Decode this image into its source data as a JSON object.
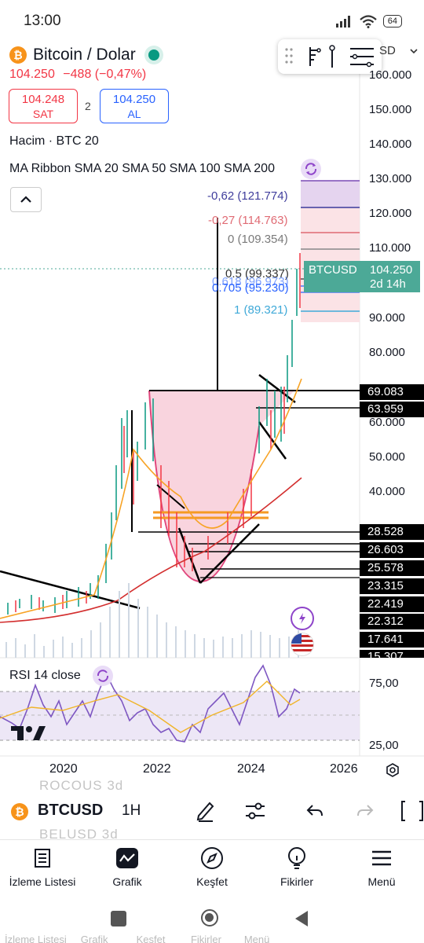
{
  "status_bar": {
    "time": "13:00",
    "battery": "64"
  },
  "header": {
    "symbol_title": "Bitcoin / Dolar",
    "price": "104.250",
    "change": "−488 (−0,47%)",
    "sell_price": "104.248",
    "sell_label": "SAT",
    "spread": "2",
    "buy_price": "104.250",
    "buy_label": "AL",
    "currency_partial": "SD"
  },
  "indicators": {
    "volume": "Hacim · BTC 20",
    "ma_ribbon": "MA Ribbon SMA 20 SMA 50 SMA 100 SMA 200",
    "rsi": "RSI 14 close"
  },
  "price_axis": [
    "160.000",
    "150.000",
    "140.000",
    "130.000",
    "120.000",
    "110.000",
    "90.000",
    "80.000",
    "60.000",
    "50.000",
    "40.000"
  ],
  "price_marks": [
    "69.083",
    "63.959",
    "28.528",
    "26.603",
    "25.578",
    "23.315",
    "22.419",
    "22.312",
    "17.641",
    "15.307"
  ],
  "last_price": {
    "symbol": "BTCUSD",
    "price": "104.250",
    "countdown": "2d 14h"
  },
  "fib_levels": [
    {
      "label": "-0,62 (121.774)",
      "color": "#3f3d9c"
    },
    {
      "label": "-0,27 (114.763)",
      "color": "#e06b74"
    },
    {
      "label": "0 (109.354)",
      "color": "#7a7a7a"
    },
    {
      "label": "0.5 (99.337)",
      "color": "#333333"
    },
    {
      "label": "0.618 (96.973)",
      "color": "#2962ff"
    },
    {
      "label": "0.705 (95.230)",
      "color": "#2962ff"
    },
    {
      "label": "1 (89.321)",
      "color": "#3fa9d8"
    }
  ],
  "rsi_axis": [
    "75,00",
    "25,00"
  ],
  "time_axis": [
    "2020",
    "2022",
    "2024",
    "2026"
  ],
  "chart_toolbar": {
    "symbol": "BTCUSD",
    "interval": "1H",
    "ghost_top": "ROCOUS  3d",
    "ghost_bottom": "BELUSD  3d"
  },
  "bottom_nav": [
    {
      "label": "İzleme Listesi",
      "icon": "watchlist-icon"
    },
    {
      "label": "Grafik",
      "icon": "chart-icon"
    },
    {
      "label": "Keşfet",
      "icon": "compass-icon"
    },
    {
      "label": "Fikirler",
      "icon": "ideas-bulb-icon"
    },
    {
      "label": "Menü",
      "icon": "menu-icon"
    }
  ],
  "ghost_nav": "İzleme Listesi     Grafik          Keşfet         Fikirler        Menü",
  "colors": {
    "up": "#089981",
    "down": "#f23645",
    "accent": "#2962ff",
    "rsi": "#7e57c2"
  }
}
